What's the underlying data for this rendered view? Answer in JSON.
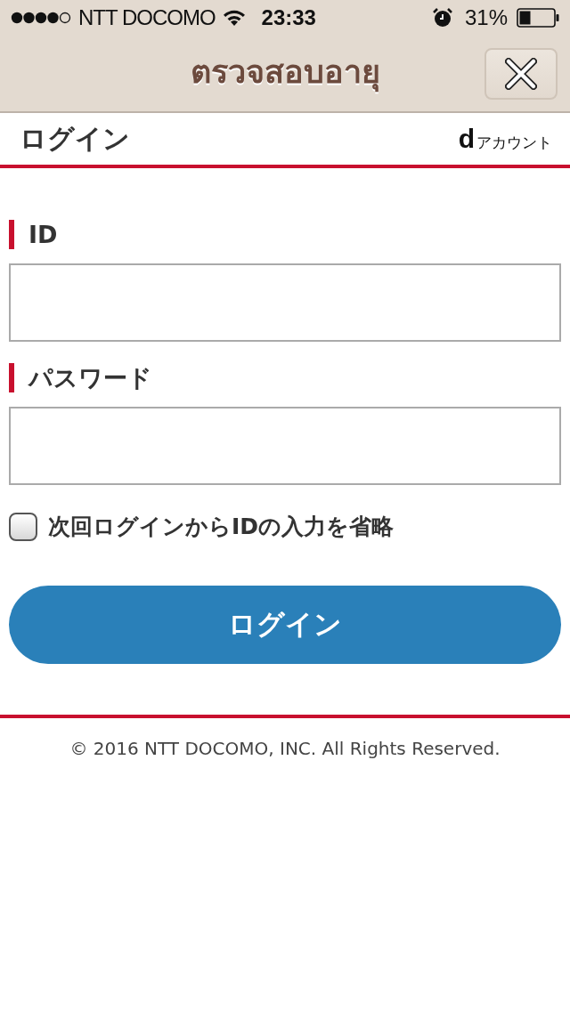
{
  "status_bar": {
    "carrier": "NTT DOCOMO",
    "time": "23:33",
    "battery": "31%"
  },
  "nav_bar": {
    "title": "ตรวจสอบอายุ"
  },
  "header": {
    "title": "ログイン",
    "brand_mark": "d",
    "brand_label": "アカウント"
  },
  "form": {
    "fields": [
      {
        "label": "ID"
      },
      {
        "label": "パスワード"
      }
    ],
    "remember": {
      "label": "次回ログインからIDの入力を省略",
      "checked": false
    },
    "submit": "ログイン"
  },
  "footer": {
    "copyright": "© 2016 NTT DOCOMO, INC. All Rights Reserved."
  }
}
